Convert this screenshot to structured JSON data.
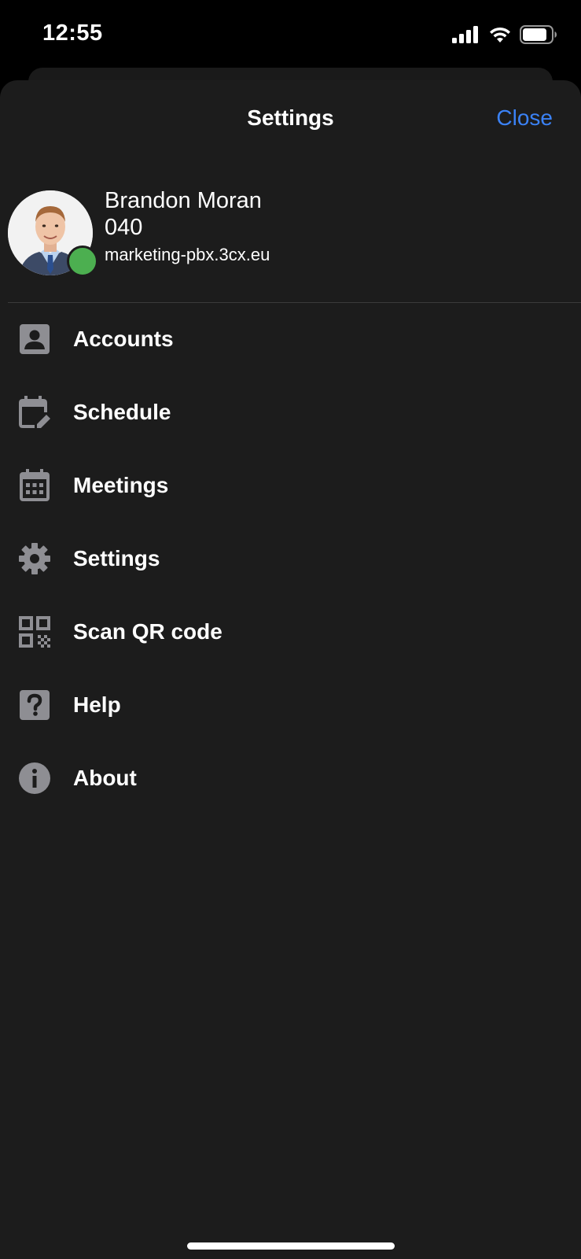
{
  "status_bar": {
    "time": "12:55",
    "icons": [
      "signal-icon",
      "wifi-icon",
      "battery-icon"
    ]
  },
  "header": {
    "title": "Settings",
    "close_label": "Close"
  },
  "profile": {
    "name": "Brandon Moran",
    "extension": "040",
    "domain": "marketing-pbx.3cx.eu",
    "presence_color": "#4caf50"
  },
  "menu": {
    "items": [
      {
        "label": "Accounts",
        "icon": "account-box-icon"
      },
      {
        "label": "Schedule",
        "icon": "calendar-edit-icon"
      },
      {
        "label": "Meetings",
        "icon": "calendar-grid-icon"
      },
      {
        "label": "Settings",
        "icon": "gear-icon"
      },
      {
        "label": "Scan QR code",
        "icon": "qr-code-icon"
      },
      {
        "label": "Help",
        "icon": "help-icon"
      },
      {
        "label": "About",
        "icon": "info-icon"
      }
    ]
  },
  "colors": {
    "accent": "#3b82f6",
    "sheet_background": "#1c1c1c",
    "icon_gray": "#8e8e93"
  }
}
